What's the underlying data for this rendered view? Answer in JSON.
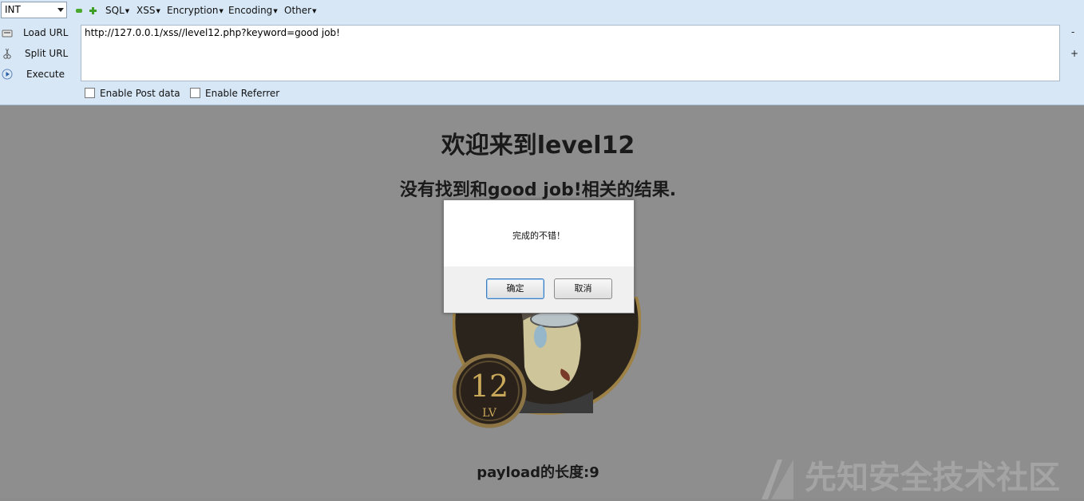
{
  "toolbar": {
    "type_select": "INT",
    "menus": [
      "SQL",
      "XSS",
      "Encryption",
      "Encoding",
      "Other"
    ],
    "load_url": "Load URL",
    "split_url": "Split URL",
    "execute": "Execute",
    "url": "http://127.0.0.1/xss//level12.php?keyword=good job!",
    "side_minus": "-",
    "side_plus": "+",
    "enable_post": "Enable Post data",
    "enable_referrer": "Enable Referrer"
  },
  "page": {
    "title": "欢迎来到level12",
    "result": "没有找到和good job!相关的结果.",
    "payload_length": "payload的长度:9",
    "badge_number": "12",
    "badge_lv": "LV"
  },
  "dialog": {
    "message": "完成的不错！",
    "ok": "确定",
    "cancel": "取消"
  },
  "watermark": "先知安全技术社区"
}
